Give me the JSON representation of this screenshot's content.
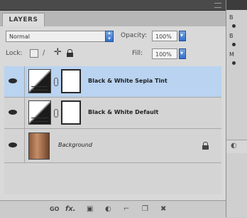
{
  "panel": {
    "tab_label": "LAYERS",
    "blend_mode": "Normal",
    "opacity_label": "Opacity:",
    "opacity_value": "100%",
    "lock_label": "Lock:",
    "fill_label": "Fill:",
    "fill_value": "100%"
  },
  "layers": [
    {
      "name": "Black & White Sepia Tint",
      "type": "adjustment",
      "visible": true,
      "selected": true
    },
    {
      "name": "Black & White Default",
      "type": "adjustment",
      "visible": true,
      "selected": false
    },
    {
      "name": "Background",
      "type": "photo",
      "visible": true,
      "selected": false,
      "locked": true
    }
  ],
  "footer": {
    "link_label": "GO",
    "fx_label": "fx."
  },
  "right_panel": {
    "letters": [
      "B",
      "B",
      "M"
    ]
  }
}
